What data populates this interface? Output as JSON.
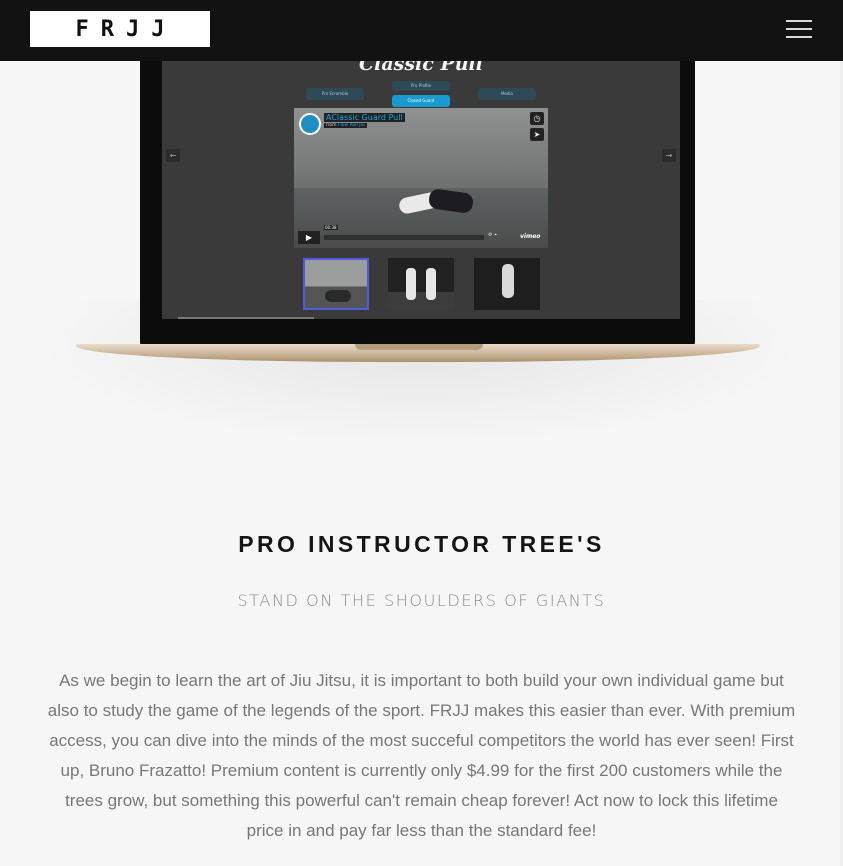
{
  "header": {
    "logo_text": "FRJJ",
    "menu_icon": "hamburger-icon"
  },
  "showcase": {
    "screen_title": "Classic Pull",
    "tabs": [
      {
        "label": "Pro Scramble",
        "active": false
      },
      {
        "label": "Pro Profile",
        "active": false
      },
      {
        "label": "Closed Guard",
        "active": true
      },
      {
        "label": "Media",
        "active": false
      }
    ],
    "prev_icon": "arrow-left-icon",
    "next_icon": "arrow-right-icon",
    "video": {
      "title": "AClassic Guard Pull",
      "from_label": "from",
      "channel": "Flow Roll Jiu",
      "time": "00:38",
      "watch_later_icon": "clock-icon",
      "share_icon": "send-icon",
      "play_icon": "play-icon",
      "brand": "vimeo"
    },
    "thumbnails": [
      {
        "name": "guard-pull-thumb",
        "selected": true
      },
      {
        "name": "standing-thumb",
        "selected": false
      },
      {
        "name": "overhead-thumb",
        "selected": false
      }
    ]
  },
  "section": {
    "heading": "PRO INSTRUCTOR TREE'S",
    "subheading": "STAND ON THE SHOULDERS OF GIANTS",
    "body_lines": [
      "As we begin to learn the art of Jiu Jitsu, it is important to both build your own individual game but",
      "also to study the game of the legends of the sport. FRJJ makes this easier than ever. With premium",
      "access, you can dive into the minds of the most succeful competitors the world has ever seen! First",
      "up, Bruno Frazatto! Premium content is currently only $4.99 for the first 200 customers while the",
      "trees grow, but something this powerful can't remain cheap forever! Act now to lock this lifetime",
      "price in and pay far less than the standard fee!"
    ]
  },
  "colors": {
    "nav_bg": "#121212",
    "page_bg": "#f6f6f6",
    "accent": "#1a9bd0"
  }
}
